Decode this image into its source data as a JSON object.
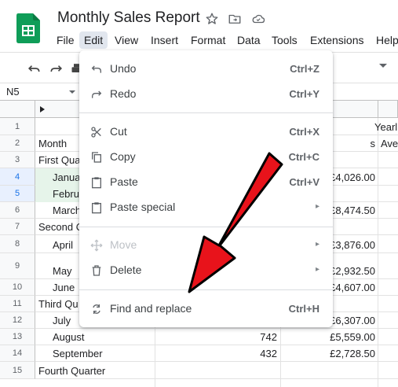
{
  "header": {
    "title": "Monthly Sales Report",
    "menu": [
      "File",
      "Edit",
      "View",
      "Insert",
      "Format",
      "Data",
      "Tools",
      "Extensions",
      "Help"
    ]
  },
  "formula_bar": {
    "name_box": "N5"
  },
  "columns": {
    "b_header_fragment": "s",
    "year_label": "Yearl",
    "avg_label": "Ave"
  },
  "rows": [
    {
      "num": "1",
      "a": "",
      "c": "",
      "d": ""
    },
    {
      "num": "2",
      "a": "Month",
      "c": "",
      "d": "s"
    },
    {
      "num": "3",
      "a": "First Quar",
      "c": "",
      "d": ""
    },
    {
      "num": "4",
      "a": "Janua",
      "c": "",
      "d": "£4,026.00"
    },
    {
      "num": "5",
      "a": "Febru",
      "c": "",
      "d": ""
    },
    {
      "num": "6",
      "a": "March",
      "c": "",
      "d": "£8,474.50"
    },
    {
      "num": "7",
      "a": "Second Q",
      "c": "",
      "d": ""
    },
    {
      "num": "8",
      "a": "April",
      "c": "",
      "d": "£3,876.00"
    },
    {
      "num": "9",
      "a": "May",
      "c": "",
      "d": "£2,932.50"
    },
    {
      "num": "10",
      "a": "June",
      "c": "",
      "d": "£4,607.00"
    },
    {
      "num": "11",
      "a": "Third Qu",
      "c": "",
      "d": ""
    },
    {
      "num": "12",
      "a": "July",
      "c": "",
      "d": "£6,307.00"
    },
    {
      "num": "13",
      "a": "August",
      "c": "742",
      "d": "£5,559.00"
    },
    {
      "num": "14",
      "a": "September",
      "c": "432",
      "d": "£2,728.50"
    },
    {
      "num": "15",
      "a": "Fourth Quarter",
      "c": "",
      "d": ""
    }
  ],
  "edit_menu": {
    "undo": {
      "label": "Undo",
      "shortcut": "Ctrl+Z"
    },
    "redo": {
      "label": "Redo",
      "shortcut": "Ctrl+Y"
    },
    "cut": {
      "label": "Cut",
      "shortcut": "Ctrl+X"
    },
    "copy": {
      "label": "Copy",
      "shortcut": "Ctrl+C"
    },
    "paste": {
      "label": "Paste",
      "shortcut": "Ctrl+V"
    },
    "paste_special": {
      "label": "Paste special",
      "submenu": "▸"
    },
    "move": {
      "label": "Move",
      "submenu": "▸"
    },
    "delete": {
      "label": "Delete",
      "submenu": "▸"
    },
    "find_replace": {
      "label": "Find and replace",
      "shortcut": "Ctrl+H"
    }
  },
  "colors": {
    "sheets_green": "#0f9d58",
    "arrow_red": "#e8131b",
    "selected_row": "#e6f4ea"
  }
}
